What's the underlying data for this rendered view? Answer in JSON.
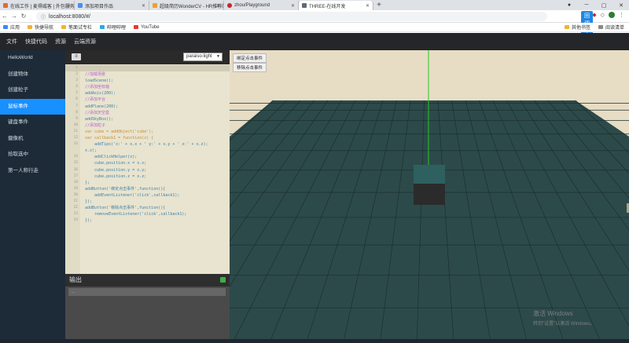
{
  "browser": {
    "tabs": [
      {
        "title": "在线工作 | 麦得威客 | 外包服务",
        "color": "#e06a3a"
      },
      {
        "title": "添加项目作品",
        "color": "#4a8df0"
      },
      {
        "title": "超级简历WonderCV - HR推荐的",
        "color": "#f0a02a"
      },
      {
        "title": "zhou/Playground",
        "color": "#c62828"
      },
      {
        "title": "THREE-在线开发",
        "color": "#5e6b7a"
      }
    ],
    "new_tab": "+",
    "url": "localhost:8080/#/",
    "login_button": "回调上传",
    "bookmarks": [
      {
        "label": "应用",
        "color": "#4285f4"
      },
      {
        "label": "快捷导航",
        "color": "#f2b233"
      },
      {
        "label": "笔面试专栏",
        "color": "#f2b233"
      },
      {
        "label": "哔哩哔哩",
        "color": "#23ade5"
      },
      {
        "label": "YouTube",
        "color": "#e53935"
      }
    ],
    "bookmarks_right": [
      "其他书签",
      "阅读清单"
    ]
  },
  "menu": {
    "items": [
      "文件",
      "快捷代码",
      "资源",
      "云端资源"
    ]
  },
  "sidebar": {
    "items": [
      "HelloWorld",
      "创建物体",
      "创建粒子",
      "鼠标事件",
      "键盘事件",
      "摄像机",
      "拾取选中",
      "第一人称行走"
    ],
    "active_index": 3
  },
  "editor": {
    "theme": "paraiso-light",
    "lines": [
      {
        "n": "1",
        "text": ""
      },
      {
        "n": "2",
        "text": "//加载场景"
      },
      {
        "n": "3",
        "text": "loadScene();"
      },
      {
        "n": "4",
        "text": "//添加坐标轴"
      },
      {
        "n": "5",
        "text": "addAxis(200);"
      },
      {
        "n": "6",
        "text": "//添加平台"
      },
      {
        "n": "7",
        "text": "addPlane(200);"
      },
      {
        "n": "8",
        "text": "//添加天空盒"
      },
      {
        "n": "9",
        "text": "addSkyBox();"
      },
      {
        "n": "10",
        "text": "//添加粒子"
      },
      {
        "n": "11",
        "text": "var cube = addObject('cube');"
      },
      {
        "n": "12",
        "text": "var callback1 = function(x) {"
      },
      {
        "n": "13",
        "text": "    addTips('x:' + x.x + ' y:' + x.y + ' z:' + x.z);"
      },
      {
        "n": "",
        "text": "x.z);"
      },
      {
        "n": "14",
        "text": "    addClickHelper(x);"
      },
      {
        "n": "15",
        "text": "    cube.position.x = x.x;"
      },
      {
        "n": "16",
        "text": "    cube.position.y = x.y;"
      },
      {
        "n": "17",
        "text": "    cube.position.z = x.z;"
      },
      {
        "n": "18",
        "text": "};"
      },
      {
        "n": "19",
        "text": "addButton('绑定点击事件',function(){"
      },
      {
        "n": "20",
        "text": "    addEventListener('click',callback1);"
      },
      {
        "n": "21",
        "text": "});"
      },
      {
        "n": "22",
        "text": "addButton('移除点击事件',function(){"
      },
      {
        "n": "23",
        "text": "    removeEventListener('click',callback1);"
      },
      {
        "n": "24",
        "text": "});"
      }
    ]
  },
  "output": {
    "title": "输出",
    "prompt": "..."
  },
  "scene": {
    "buttons": [
      "绑定点击事件",
      "移除点击事件"
    ],
    "watermark_title": "激活 Windows",
    "watermark_sub": "转到\"设置\"以激活 Windows。"
  },
  "colors": {
    "accent": "#1890ff",
    "sidebar_bg": "#1d2b38",
    "editor_bg": "#e8e4cf",
    "floor": "#2d4a4a",
    "axis": "#22cc22"
  }
}
